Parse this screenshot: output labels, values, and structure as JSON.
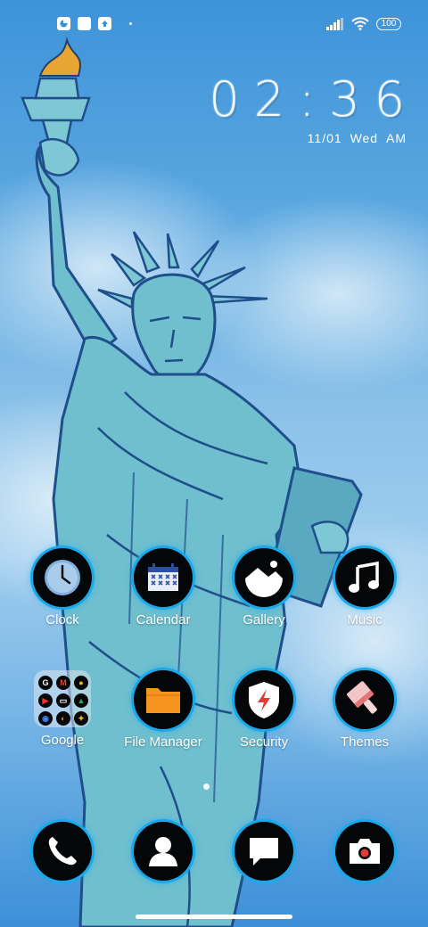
{
  "status_bar": {
    "battery_level": "100",
    "left_icons": [
      "notification-app-icon",
      "notification-square-icon",
      "notification-upload-icon"
    ],
    "right_icons": [
      "signal-icon",
      "wifi-icon",
      "battery-icon"
    ]
  },
  "clock_widget": {
    "time": "02:36",
    "date": "11/01",
    "weekday": "Wed",
    "ampm": "AM"
  },
  "apps": {
    "clock": {
      "label": "Clock",
      "icon": "clock-icon"
    },
    "calendar": {
      "label": "Calendar",
      "icon": "calendar-icon"
    },
    "gallery": {
      "label": "Gallery",
      "icon": "gallery-icon"
    },
    "music": {
      "label": "Music",
      "icon": "music-icon"
    },
    "google": {
      "label": "Google",
      "icon": "folder-icon"
    },
    "file_manager": {
      "label": "File Manager",
      "icon": "folder-orange-icon"
    },
    "security": {
      "label": "Security",
      "icon": "shield-bolt-icon"
    },
    "themes": {
      "label": "Themes",
      "icon": "paintbrush-icon"
    }
  },
  "dock": {
    "phone": {
      "icon": "phone-icon"
    },
    "contacts": {
      "icon": "contact-icon"
    },
    "messages": {
      "icon": "message-icon"
    },
    "camera": {
      "icon": "camera-icon"
    }
  },
  "colors": {
    "accent_ring": "#1aa8e8",
    "icon_bg": "#050608",
    "file_manager_orange": "#f59520"
  }
}
